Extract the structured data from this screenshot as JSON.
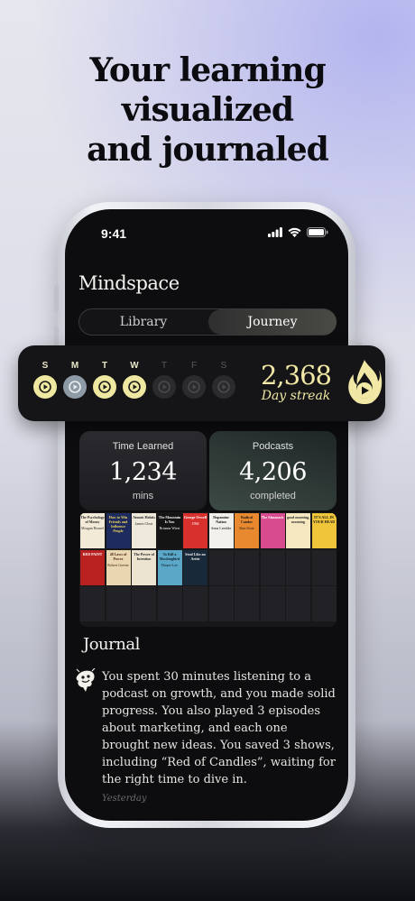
{
  "headline": {
    "line1": "Your learning visualized",
    "line2": "and journaled"
  },
  "status_bar": {
    "time": "9:41"
  },
  "app": {
    "title": "Mindspace",
    "tabs": [
      {
        "label": "Library",
        "active": false
      },
      {
        "label": "Journey",
        "active": true
      }
    ]
  },
  "streak": {
    "days": [
      {
        "letter": "S",
        "state": "done"
      },
      {
        "letter": "M",
        "state": "today"
      },
      {
        "letter": "T",
        "state": "done"
      },
      {
        "letter": "W",
        "state": "done"
      },
      {
        "letter": "T",
        "state": "missed"
      },
      {
        "letter": "F",
        "state": "missed"
      },
      {
        "letter": "S",
        "state": "missed"
      }
    ],
    "count": "2,368",
    "label": "Day streak",
    "icon": "flame-play-icon",
    "accent_color": "#f0e8a4"
  },
  "stats": {
    "time_learned": {
      "label": "Time Learned",
      "value": "1,234",
      "unit": "mins"
    },
    "podcasts": {
      "label": "Podcasts",
      "value": "4,206",
      "unit": "completed"
    }
  },
  "books": [
    {
      "title": "The Psychology of Money",
      "author": "Morgan Housel",
      "bg": "#f2ead6",
      "fg": "#2a2a2a"
    },
    {
      "title": "How to Win Friends and Influence People",
      "author": "",
      "bg": "#1d2c5c",
      "fg": "#f2d45e"
    },
    {
      "title": "Atomic Habits",
      "author": "James Clear",
      "bg": "#efe9dc",
      "fg": "#1d1d1d"
    },
    {
      "title": "The Mountain Is You",
      "author": "Brianna Wiest",
      "bg": "#141414",
      "fg": "#f0f0f0"
    },
    {
      "title": "George Orwell",
      "author": "1984",
      "bg": "#d8302d",
      "fg": "#ffffff"
    },
    {
      "title": "Dopamine Nation",
      "author": "Anna Lembke",
      "bg": "#f2f0ea",
      "fg": "#111111"
    },
    {
      "title": "Radical Candor",
      "author": "Kim Scott",
      "bg": "#e8892f",
      "fg": "#1a1a1a"
    },
    {
      "title": "The Almanack",
      "author": "",
      "bg": "#d84b8e",
      "fg": "#ffffff"
    },
    {
      "title": "good morning, morning",
      "author": "",
      "bg": "#f5e7c0",
      "fg": "#2a2a2a"
    },
    {
      "title": "IT'S ALL IN YOUR HEAD",
      "author": "",
      "bg": "#f1c53a",
      "fg": "#1a1a1a"
    },
    {
      "title": "RED PAINT",
      "author": "",
      "bg": "#b8211f",
      "fg": "#ffffff"
    },
    {
      "title": "48 Laws of Power",
      "author": "Robert Greene",
      "bg": "#e8d7b0",
      "fg": "#4a1b14"
    },
    {
      "title": "The Power of Intention",
      "author": "",
      "bg": "#ece3d0",
      "fg": "#2a2a2a"
    },
    {
      "title": "To Kill a Mockingbird",
      "author": "Harper Lee",
      "bg": "#5aa7c7",
      "fg": "#10202a"
    },
    {
      "title": "Steal Like an Artist",
      "author": "",
      "bg": "#182a3a",
      "fg": "#f2f2f2"
    }
  ],
  "journal": {
    "title": "Journal",
    "entry": "You spent 30 minutes listening to a podcast on growth, and you made solid progress. You also played 3 episodes about marketing, and each one brought new ideas. You saved 3 shows, including “Red of Candles”, waiting for the right time to dive in.",
    "date": "Yesterday",
    "icon": "journal-sketch-icon"
  }
}
